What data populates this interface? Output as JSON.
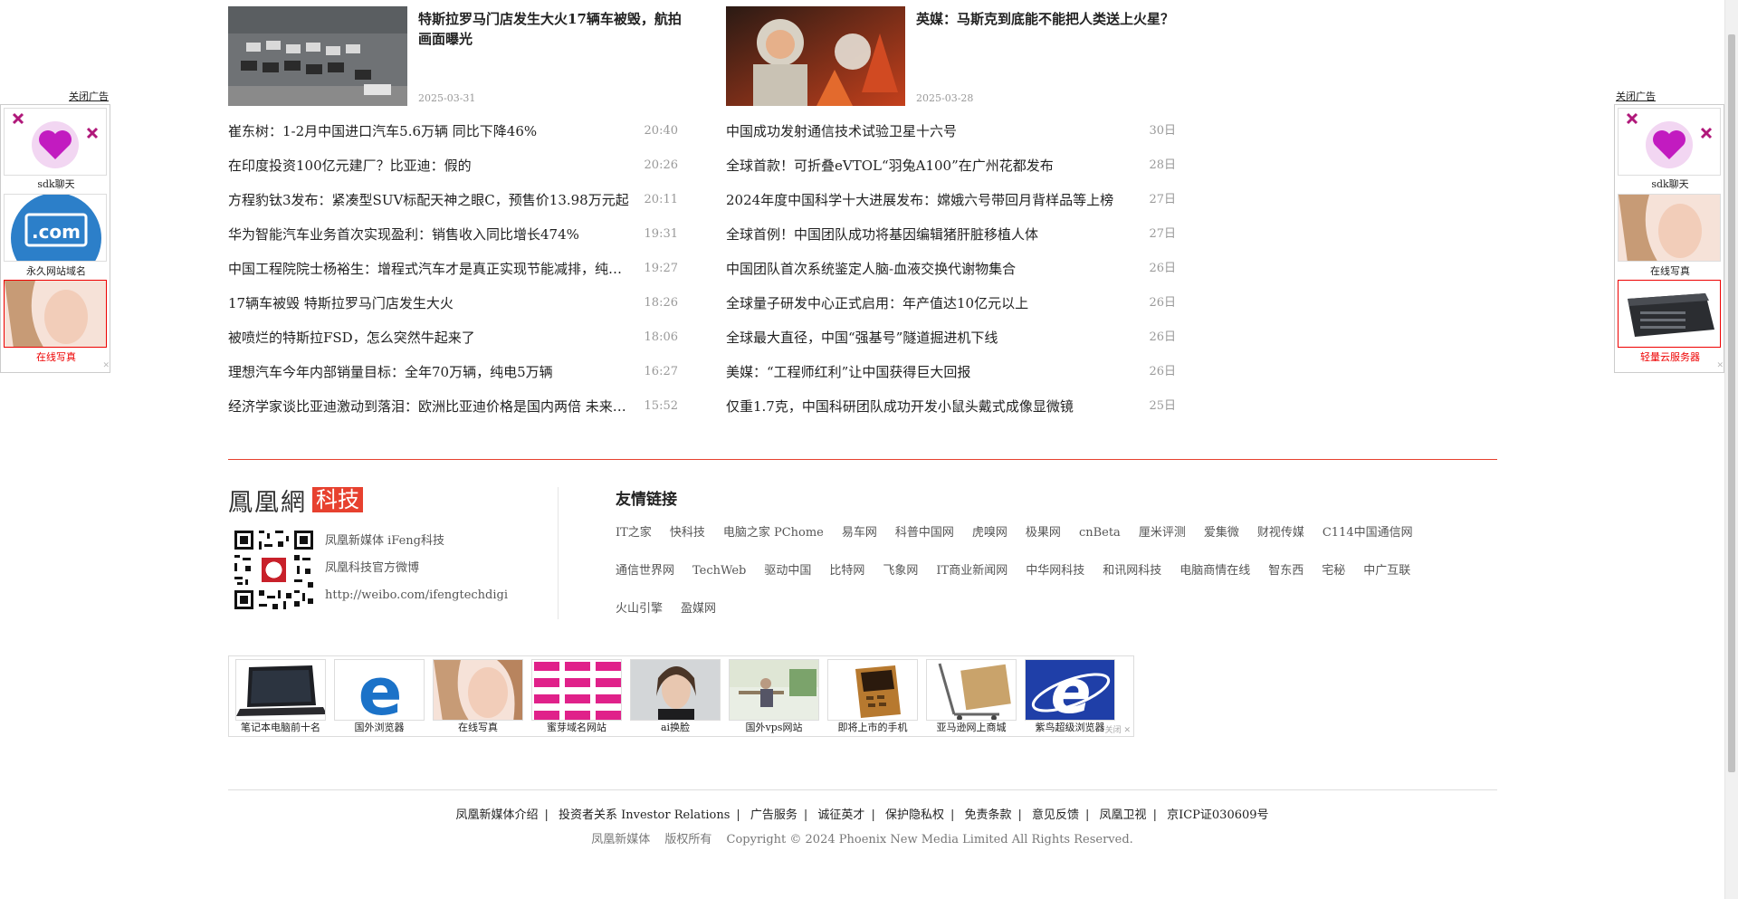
{
  "cards": [
    {
      "title": "特斯拉罗马门店发生大火17辆车被毁，航拍画面曝光",
      "date": "2025-03-31"
    },
    {
      "title": "英媒：马斯克到底能不能把人类送上火星？",
      "date": "2025-03-28"
    }
  ],
  "left_news": [
    {
      "title": "崔东树：1-2月中国进口汽车5.6万辆 同比下降46%",
      "time": "20:40"
    },
    {
      "title": "在印度投资100亿元建厂？比亚迪：假的",
      "time": "20:26"
    },
    {
      "title": "方程豹钛3发布：紧凑型SUV标配天神之眼C，预售价13.98万元起",
      "time": "20:11"
    },
    {
      "title": "华为智能汽车业务首次实现盈利：销售收入同比增长474%",
      "time": "19:31"
    },
    {
      "title": "中国工程院院士杨裕生：增程式汽车才是真正实现节能减排，纯电车只是转移排放",
      "time": "19:27"
    },
    {
      "title": "17辆车被毁 特斯拉罗马门店发生大火",
      "time": "18:26"
    },
    {
      "title": "被喷烂的特斯拉FSD，怎么突然牛起来了",
      "time": "18:06"
    },
    {
      "title": "理想汽车今年内部销量目标：全年70万辆，纯电5万辆",
      "time": "16:27"
    },
    {
      "title": "经济学家谈比亚迪激动到落泪：欧洲比亚迪价格是国内两倍 未来会更好",
      "time": "15:52"
    }
  ],
  "right_news": [
    {
      "title": "中国成功发射通信技术试验卫星十六号",
      "time": "30日"
    },
    {
      "title": "全球首款！可折叠eVTOL“羽兔A100”在广州花都发布",
      "time": "28日"
    },
    {
      "title": "2024年度中国科学十大进展发布：嫦娥六号带回月背样品等上榜",
      "time": "27日"
    },
    {
      "title": "全球首例！中国团队成功将基因编辑猪肝脏移植人体",
      "time": "27日"
    },
    {
      "title": "中国团队首次系统鉴定人脑-血液交换代谢物集合",
      "time": "26日"
    },
    {
      "title": "全球量子研发中心正式启用：年产值达10亿元以上",
      "time": "26日"
    },
    {
      "title": "全球最大直径，中国“强基号”隧道掘进机下线",
      "time": "26日"
    },
    {
      "title": "美媒：“工程师红利”让中国获得巨大回报",
      "time": "26日"
    },
    {
      "title": "仅重1.7克，中国科研团队成功开发小鼠头戴式成像显微镜",
      "time": "25日"
    }
  ],
  "footer_brand": {
    "logo_main": "鳳凰網",
    "logo_tag": "科技",
    "links": [
      "凤凰新媒体 iFeng科技",
      "凤凰科技官方微博",
      "http://weibo.com/ifengtechdigi"
    ]
  },
  "friend_links": {
    "title": "友情链接",
    "items": [
      "IT之家",
      "快科技",
      "电脑之家 PChome",
      "易车网",
      "科普中国网",
      "虎嗅网",
      "极果网",
      "cnBeta",
      "厘米评测",
      "爱集微",
      "财视传媒",
      "C114中国通信网",
      "通信世界网",
      "TechWeb",
      "驱动中国",
      "比特网",
      "飞象网",
      "IT商业新闻网",
      "中华网科技",
      "和讯网科技",
      "电脑商情在线",
      "智东西",
      "宅秘",
      "中广互联",
      "火山引擎",
      "盈媒网"
    ]
  },
  "ad_strip": {
    "items": [
      "笔记本电脑前十名",
      "国外浏览器",
      "在线写真",
      "蜜芽域名网站",
      "ai换脸",
      "国外vps网站",
      "即将上市的手机",
      "亚马逊网上商城",
      "紫鸟超级浏览器"
    ],
    "close": "关闭 ✕"
  },
  "side_left": {
    "close": "关闭广告",
    "items": [
      "sdk聊天",
      "永久网站域名",
      "在线写真"
    ]
  },
  "side_right": {
    "close": "关闭广告",
    "items": [
      "sdk聊天",
      "在线写真",
      "轻量云服务器"
    ]
  },
  "bottom_links": [
    "凤凰新媒体介绍",
    "投资者关系 Investor Relations",
    "广告服务",
    "诚征英才",
    "保护隐私权",
    "免责条款",
    "意见反馈",
    "凤凰卫视",
    "京ICP证030609号"
  ],
  "copyright": [
    "凤凰新媒体",
    "版权所有",
    "Copyright © 2024 Phoenix New Media Limited All Rights Reserved."
  ]
}
